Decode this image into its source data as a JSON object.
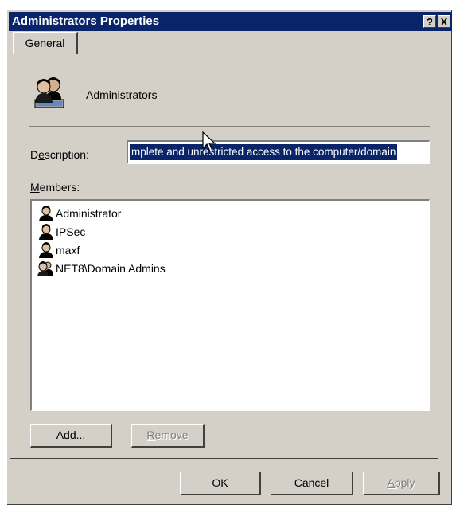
{
  "window": {
    "title": "Administrators Properties",
    "help_glyph": "?",
    "close_glyph": "X"
  },
  "tabs": [
    {
      "label": "General",
      "active": true
    }
  ],
  "group": {
    "name": "Administrators",
    "icon": "group-icon"
  },
  "description": {
    "label_prefix": "D",
    "label_underlined": "e",
    "label_suffix": "scription:",
    "value": "mplete and unrestricted access to the computer/domain"
  },
  "members": {
    "label_underlined": "M",
    "label_suffix": "embers:",
    "items": [
      {
        "name": "Administrator",
        "icon": "user-icon"
      },
      {
        "name": "IPSec",
        "icon": "user-icon"
      },
      {
        "name": "maxf",
        "icon": "user-icon"
      },
      {
        "name": "NET8\\Domain Admins",
        "icon": "group-icon"
      }
    ]
  },
  "buttons": {
    "add": {
      "prefix": "A",
      "underlined": "d",
      "suffix": "d..."
    },
    "remove": {
      "underlined": "R",
      "suffix": "emove",
      "disabled": true
    },
    "ok": "OK",
    "cancel": "Cancel",
    "apply": {
      "prefix": "",
      "underlined": "A",
      "suffix": "pply",
      "disabled": true
    }
  },
  "colors": {
    "titlebar": "#0a246a",
    "face": "#d4d0c8",
    "selection": "#0a246a"
  }
}
